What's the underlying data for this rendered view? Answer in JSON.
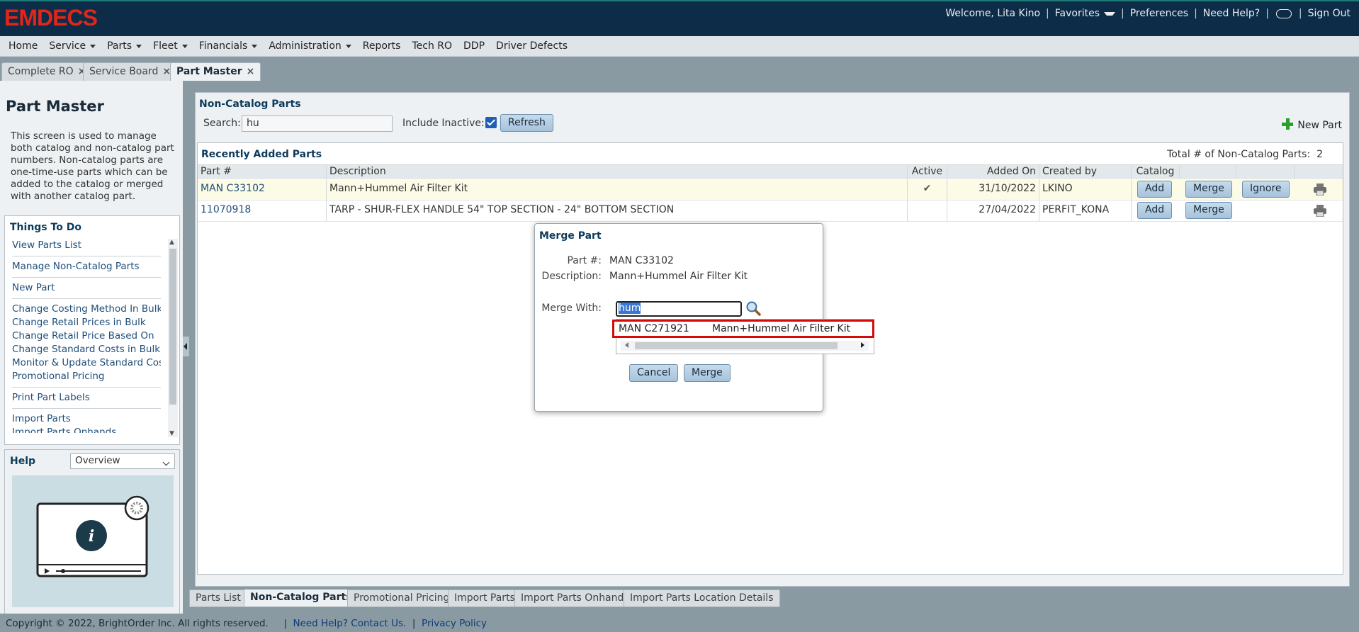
{
  "header": {
    "logo": "EMDECS",
    "welcome": "Welcome, Lita Kino",
    "favorites": "Favorites",
    "preferences": "Preferences",
    "need_help": "Need Help?",
    "sign_out": "Sign Out",
    "separator": "|"
  },
  "menu": [
    "Home",
    "Service",
    "Parts",
    "Fleet",
    "Financials",
    "Administration",
    "Reports",
    "Tech RO",
    "DDP",
    "Driver Defects"
  ],
  "page_tabs": [
    "Complete RO",
    "Service Board",
    "Part Master"
  ],
  "left": {
    "title": "Part Master",
    "description": "This screen is used to manage both catalog and non-catalog part numbers. Non-catalog parts are one-time-use parts which can be added to the catalog or merged with another catalog part.",
    "things_title": "Things To Do",
    "things": [
      [
        "View Parts List"
      ],
      [
        "Manage Non-Catalog Parts"
      ],
      [
        "New Part"
      ],
      [
        "Change Costing Method In Bulk",
        "Change Retail Prices in Bulk",
        "Change Retail Price Based On",
        "Change Standard Costs in Bulk",
        "Monitor & Update Standard Costs",
        "Promotional Pricing"
      ],
      [
        "Print Part Labels"
      ],
      [
        "Import Parts",
        "Import Parts Onhands"
      ]
    ],
    "help_title": "Help",
    "help_option": "Overview"
  },
  "noncatalog": {
    "title": "Non-Catalog Parts",
    "search_label": "Search:",
    "search_value": "hu",
    "include_inactive": "Include Inactive:",
    "refresh": "Refresh",
    "new_part": "New Part"
  },
  "grid": {
    "title": "Recently Added Parts",
    "total_label": "Total # of Non-Catalog Parts:",
    "total": "2",
    "columns": [
      "Part #",
      "Description",
      "Active",
      "Added On",
      "Created by",
      "Catalog"
    ],
    "rows": [
      {
        "part": "MAN C33102",
        "desc": "Mann+Hummel Air Filter Kit",
        "active": "✔",
        "added": "31/10/2022",
        "by": "LKINO",
        "add": "Add",
        "merge": "Merge",
        "ignore": "Ignore"
      },
      {
        "part": "11070918",
        "desc": "TARP - SHUR-FLEX HANDLE 54\" TOP SECTION - 24\" BOTTOM SECTION",
        "active": "",
        "added": "27/04/2022",
        "by": "PERFIT_KONA",
        "add": "Add",
        "merge": "Merge",
        "ignore": ""
      }
    ]
  },
  "subtabs": [
    "Parts List",
    "Non-Catalog Parts",
    "Promotional Pricing",
    "Import Parts",
    "Import Parts Onhands",
    "Import Parts Location Details"
  ],
  "modal": {
    "title": "Merge Part",
    "part_label": "Part #:",
    "part_value": "MAN C33102",
    "desc_label": "Description:",
    "desc_value": "Mann+Hummel Air Filter Kit",
    "merge_with_label": "Merge With:",
    "merge_with_value": "hum",
    "suggestion_part": "MAN C271921",
    "suggestion_desc": "Mann+Hummel Air Filter Kit",
    "cancel": "Cancel",
    "merge": "Merge"
  },
  "footer": {
    "copyright": "Copyright © 2022, BrightOrder Inc. All rights reserved.",
    "help": "Need Help? Contact Us.",
    "privacy": "Privacy Policy"
  },
  "colors": {
    "header_bg": "#0d2c47",
    "logo_red": "#e0261b",
    "accent_blue": "#1f4e79",
    "highlight_red": "#d50b0b"
  }
}
